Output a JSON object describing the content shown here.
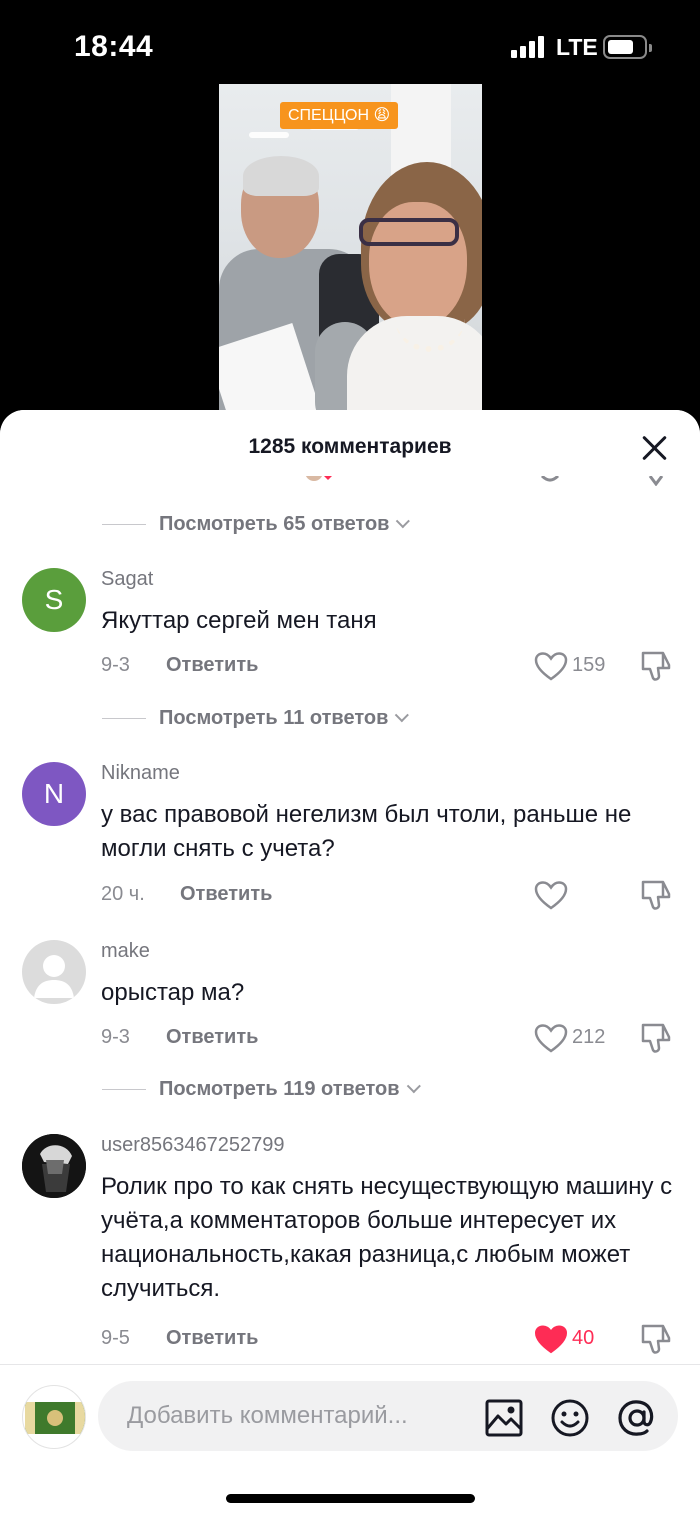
{
  "status_bar": {
    "time": "18:44",
    "network": "LTE"
  },
  "video": {
    "caption": "СПЕЦЦОН 😩"
  },
  "comments_sheet": {
    "title": "1285 комментариев",
    "close_icon": "close-icon"
  },
  "threads": [
    {
      "replies_label": "Посмотреть 65 ответов"
    },
    {
      "replies_label": "Посмотреть 11 ответов"
    },
    {
      "replies_label": "Посмотреть 119 ответов"
    }
  ],
  "comments": [
    {
      "author": "Sagat",
      "avatar_letter": "S",
      "avatar_color": "#5a9e3c",
      "text": "Якуттар сергей мен таня",
      "time": "9-3",
      "reply_label": "Ответить",
      "likes": "159",
      "liked": false
    },
    {
      "author": "Nikname",
      "avatar_letter": "N",
      "avatar_color": "#7e57c2",
      "text": "у вас правовой негелизм был чтоли, раньше не могли снять с учета?",
      "time": "20 ч.",
      "reply_label": "Ответить",
      "likes": "",
      "liked": false
    },
    {
      "author": "make",
      "avatar_letter": "",
      "avatar_color": "#dcdcdc",
      "text": "орыстар ма?",
      "time": "9-3",
      "reply_label": "Ответить",
      "likes": "212",
      "liked": false
    },
    {
      "author": "user8563467252799",
      "avatar_letter": "",
      "avatar_color": "#1a1a1a",
      "text": "Ролик про то как снять несуществующую машину с учёта,а комментаторов больше интересует их национальность,какая разница,с любым может случиться.",
      "time": "9-5",
      "reply_label": "Ответить",
      "likes": "40",
      "liked": true
    }
  ],
  "input_bar": {
    "placeholder": "Добавить комментарий...",
    "tools": [
      "image-icon",
      "emoji-icon",
      "mention-icon"
    ]
  },
  "colors": {
    "liked": "#fe2c55",
    "accent_label": "#f7941d"
  }
}
